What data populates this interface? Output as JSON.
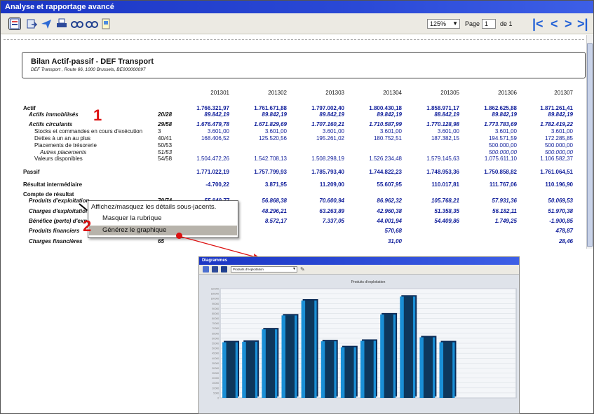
{
  "app": {
    "title": "Analyse et rapportage avancé"
  },
  "toolbar": {
    "icons": [
      "report-layout-icon",
      "export-icon",
      "send-icon",
      "print-icon",
      "find-icon",
      "find-next-icon",
      "page-setup-icon"
    ],
    "zoom_value": "125%",
    "page_label": "Page",
    "page_value": "1",
    "page_of": "de 1"
  },
  "report": {
    "title": "Bilan Actif-passif - DEF Transport",
    "subtitle": "DEF Transport , Route 66, 1000 Brussels, BE000000097",
    "periods": [
      "201301",
      "201302",
      "201303",
      "201304",
      "201305",
      "201306",
      "201307"
    ],
    "rows": [
      {
        "label": "Actif",
        "code": "",
        "values": [
          "1.766.321,97",
          "1.761.671,88",
          "1.797.002,40",
          "1.800.430,18",
          "1.858.971,17",
          "1.862.625,88",
          "1.871.261,41"
        ],
        "style": "b",
        "indent": 0
      },
      {
        "label": "Actifs immobilisés",
        "code": "20/28",
        "values": [
          "89.842,19",
          "89.842,19",
          "89.842,19",
          "89.842,19",
          "88.842,19",
          "89.842,19",
          "89.842,19"
        ],
        "style": "bi",
        "indent": 8
      },
      {
        "label": "Actifs circulants",
        "code": "29/58",
        "values": [
          "1.676.479,78",
          "1.671.829,69",
          "1.707.160,21",
          "1.710.587,99",
          "1.770.128,98",
          "1.773.783,69",
          "1.782.419,22"
        ],
        "style": "bi",
        "indent": 8
      },
      {
        "label": "Stocks et commandes en cours d'exécution",
        "code": "3",
        "values": [
          "3.601,00",
          "3.601,00",
          "3.601,00",
          "3.601,00",
          "3.601,00",
          "3.601,00",
          "3.601,00"
        ],
        "style": "",
        "indent": 16
      },
      {
        "label": "Dettes à un an au plus",
        "code": "40/41",
        "values": [
          "168.406,52",
          "125.520,56",
          "195.261,02",
          "180.752,51",
          "187.382,15",
          "194.571,59",
          "172.285,85"
        ],
        "style": "",
        "indent": 16
      },
      {
        "label": "Placements de trésorerie",
        "code": "50/53",
        "values": [
          "",
          "",
          "",
          "",
          "",
          "500.000,00",
          "500.000,00"
        ],
        "style": "",
        "indent": 16
      },
      {
        "label": "Autres placements",
        "code": "51/53",
        "values": [
          "",
          "",
          "",
          "",
          "",
          "500.000,00",
          "500.000,00"
        ],
        "style": "it",
        "indent": 24
      },
      {
        "label": "Valeurs disponibles",
        "code": "54/58",
        "values": [
          "1.504.472,26",
          "1.542.708,13",
          "1.508.298,19",
          "1.526.234,48",
          "1.579.145,63",
          "1.075.611,10",
          "1.106.582,37"
        ],
        "style": "",
        "indent": 16
      },
      {
        "label": "Passif",
        "code": "",
        "values": [
          "1.771.022,19",
          "1.757.799,93",
          "1.785.793,40",
          "1.744.822,23",
          "1.748.953,36",
          "1.750.858,82",
          "1.761.064,51"
        ],
        "style": "b",
        "indent": 0
      },
      {
        "label": "Résultat intermédiaire",
        "code": "",
        "values": [
          "-4.700,22",
          "3.871,95",
          "11.209,00",
          "55.607,95",
          "110.017,81",
          "111.767,06",
          "110.196,90"
        ],
        "style": "b",
        "indent": 0
      },
      {
        "label": "Compte de résultat",
        "code": "",
        "values": [
          "",
          "",
          "",
          "",
          "",
          "",
          ""
        ],
        "style": "b",
        "indent": 0
      },
      {
        "label": "Produits d'exploitation",
        "code": "70/74",
        "values": [
          "55.840,77",
          "56.868,38",
          "70.600,94",
          "86.962,32",
          "105.768,21",
          "57.931,36",
          "50.069,53"
        ],
        "style": "bi",
        "indent": 8
      },
      {
        "label": "Charges d'exploitation",
        "code": "",
        "values": [
          "",
          "48.296,21",
          "63.263,89",
          "42.960,38",
          "51.358,35",
          "56.182,11",
          "51.970,38"
        ],
        "style": "bi",
        "indent": 8
      },
      {
        "label": "Bénéfice (perte) d'exploitation",
        "code": "",
        "values": [
          "",
          "8.572,17",
          "7.337,05",
          "44.001,94",
          "54.409,86",
          "1.749,25",
          "-1.900,85"
        ],
        "style": "bi",
        "indent": 8
      },
      {
        "label": "Produits financiers",
        "code": "",
        "values": [
          "",
          "",
          "",
          "570,68",
          "",
          "",
          "478,87"
        ],
        "style": "bi",
        "indent": 8
      },
      {
        "label": "Charges financières",
        "code": "65",
        "values": [
          "",
          "",
          "",
          "31,00",
          "",
          "",
          "28,46"
        ],
        "style": "bi",
        "indent": 8
      }
    ]
  },
  "context_menu": {
    "tooltip": "Affichez/masquez les détails sous-jacents.",
    "items": [
      "Masquer la rubrique",
      "Générez le graphique"
    ]
  },
  "markers": {
    "one": "1",
    "two": "2"
  },
  "chart_window": {
    "title": "Diagrammes",
    "select_value": "Produits d'exploitation"
  },
  "colors": {
    "accent": "#2a49d6",
    "marker": "#dd1111",
    "value_text": "#0f1d9a"
  },
  "chart_data": {
    "type": "bar",
    "title": "Produits d'exploitation",
    "categories": [
      "",
      "",
      "",
      "",
      "",
      "",
      "",
      "",
      "",
      "",
      "",
      "",
      "",
      "",
      ""
    ],
    "values": [
      56000,
      56500,
      69000,
      83000,
      98000,
      57000,
      51000,
      57500,
      84000,
      102000,
      61000,
      56000,
      0,
      0,
      0
    ],
    "ylim": [
      0,
      110000
    ],
    "ytick_step": 5000,
    "grid": true,
    "bar_color": "#1a8fd6"
  }
}
